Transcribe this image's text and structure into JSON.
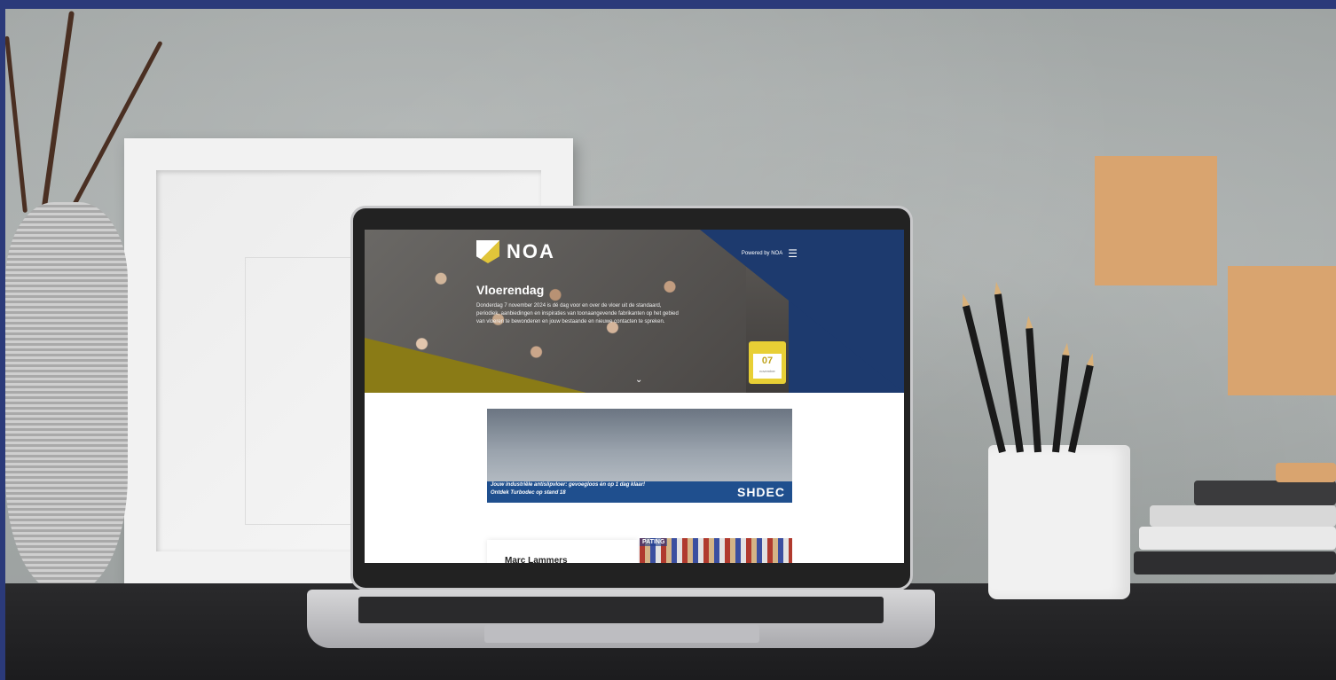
{
  "site": {
    "logo_text": "NOA",
    "powered_by": "Powered by NOA",
    "menu_icon": "hamburger-icon"
  },
  "hero": {
    "title": "Vloerendag",
    "description": "Donderdag 7 november 2024 is dé dag voor en over de vloer uit de standaard, periodiek, aanbiedingen en inspiraties van toonaangevende fabrikanten op het gebied van vloeren te bewonderen en jouw bestaande en nieuwe contacten te spreken.",
    "calendar": {
      "day": "07",
      "month": "november"
    },
    "scroll_icon": "chevron-down-icon"
  },
  "ad": {
    "line1": "Jouw industriële antislipvloer: gevoegloos én op 1 dag klaar!",
    "line2": "Ontdek Turbodec op stand 18",
    "brand": "SHDEC"
  },
  "speaker": {
    "name": "Marc Lammers"
  },
  "photo": {
    "label": "PATING"
  },
  "colors": {
    "brand_blue": "#1d3a6e",
    "brand_olive": "#8a7b16",
    "calendar_yellow": "#e8cf35"
  }
}
